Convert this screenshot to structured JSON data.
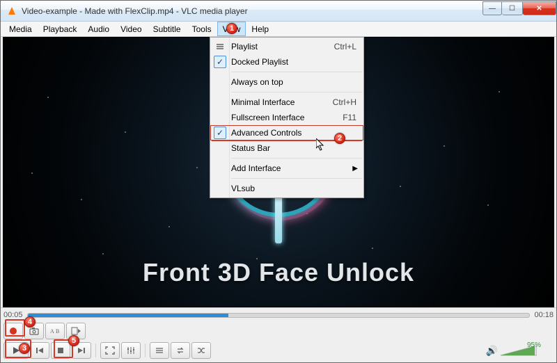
{
  "window": {
    "title": "Video-example - Made with FlexClip.mp4 - VLC media player"
  },
  "menubar": {
    "items": [
      {
        "label": "Media"
      },
      {
        "label": "Playback"
      },
      {
        "label": "Audio"
      },
      {
        "label": "Video"
      },
      {
        "label": "Subtitle"
      },
      {
        "label": "Tools"
      },
      {
        "label": "View"
      },
      {
        "label": "Help"
      }
    ],
    "active_index": 6
  },
  "view_menu": {
    "playlist": {
      "label": "Playlist",
      "shortcut": "Ctrl+L"
    },
    "docked_playlist": {
      "label": "Docked Playlist"
    },
    "always_on_top": {
      "label": "Always on top"
    },
    "minimal": {
      "label": "Minimal Interface",
      "shortcut": "Ctrl+H"
    },
    "fullscreen": {
      "label": "Fullscreen Interface",
      "shortcut": "F11"
    },
    "advanced": {
      "label": "Advanced Controls"
    },
    "status_bar": {
      "label": "Status Bar"
    },
    "add_interface": {
      "label": "Add Interface"
    },
    "vlsub": {
      "label": "VLsub"
    }
  },
  "video_overlay": {
    "label": "Front 3D Face Unlock"
  },
  "time": {
    "current": "00:05",
    "total": "00:18"
  },
  "volume": {
    "percent": "95%"
  },
  "icons": {
    "minimize": "—",
    "maximize": "☐",
    "close": "✕",
    "check": "✓",
    "submenu": "▶",
    "speaker": "🔊"
  },
  "annotations": {
    "b1": "1",
    "b2": "2",
    "b3": "3",
    "b4": "4",
    "b5": "5"
  }
}
